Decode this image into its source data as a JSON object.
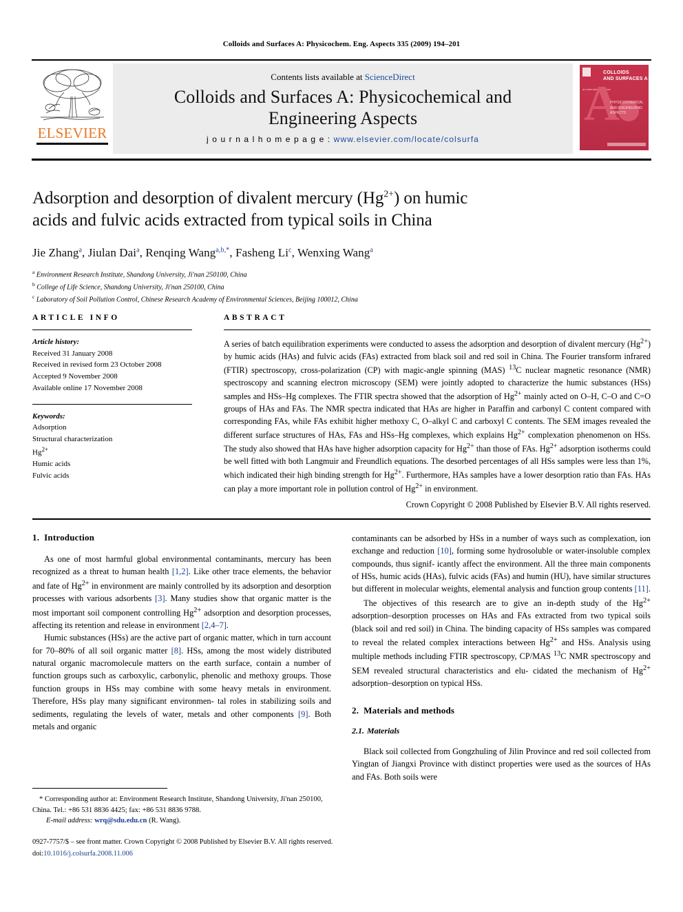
{
  "running_head": "Colloids and Surfaces A: Physicochem. Eng. Aspects 335 (2009) 194–201",
  "masthead": {
    "publisher_name": "ELSEVIER",
    "contents_prefix": "Contents lists available at ",
    "contents_link": "ScienceDirect",
    "journal_title_line1": "Colloids and Surfaces A: Physicochemical and",
    "journal_title_line2": "Engineering Aspects",
    "homepage_label": "j o u r n a l  h o m e p a g e :",
    "homepage_url": "www.elsevier.com/locate/colsurfa",
    "cover": {
      "line1": "COLLOIDS",
      "line2": "AND SURFACES A",
      "letter": "A",
      "subtitle": "PHYSICOCHEMICAL AND ENGINEERING ASPECTS",
      "small_top": "an international journal"
    }
  },
  "title": {
    "line1_a": "Adsorption and desorption of divalent mercury (Hg",
    "line1_sup": "2+",
    "line1_b": ") on humic",
    "line2": "acids and fulvic acids extracted from typical soils in China"
  },
  "authors": [
    {
      "name": "Jie Zhang",
      "sup": "a"
    },
    {
      "name": "Jiulan Dai",
      "sup": "a"
    },
    {
      "name": "Renqing Wang",
      "sup": "a,b,*"
    },
    {
      "name": "Fasheng Li",
      "sup": "c"
    },
    {
      "name": "Wenxing Wang",
      "sup": "a"
    }
  ],
  "affiliations": [
    {
      "mark": "a",
      "text": "Environment Research Institute, Shandong University, Ji'nan 250100, China"
    },
    {
      "mark": "b",
      "text": "College of Life Science, Shandong University, Ji'nan 250100, China"
    },
    {
      "mark": "c",
      "text": "Laboratory of Soil Pollution Control, Chinese Research Academy of Environmental Sciences, Beijing 100012, China"
    }
  ],
  "article_info": {
    "heading": "ARTICLE INFO",
    "history_label": "Article history:",
    "history": [
      "Received 31 January 2008",
      "Received in revised form 23 October 2008",
      "Accepted 9 November 2008",
      "Available online 17 November 2008"
    ],
    "keywords_label": "Keywords:",
    "keywords": [
      "Adsorption",
      "Structural characterization",
      "Hg2+",
      "Humic acids",
      "Fulvic acids"
    ]
  },
  "abstract": {
    "heading": "ABSTRACT",
    "text": "A series of batch equilibration experiments were conducted to assess the adsorption and desorption of divalent mercury (Hg2+) by humic acids (HAs) and fulvic acids (FAs) extracted from black soil and red soil in China. The Fourier transform infrared (FTIR) spectroscopy, cross-polarization (CP) with magic-angle spinning (MAS) 13C nuclear magnetic resonance (NMR) spectroscopy and scanning electron microscopy (SEM) were jointly adopted to characterize the humic substances (HSs) samples and HSs–Hg complexes. The FTIR spectra showed that the adsorption of Hg2+ mainly acted on O–H, C–O and C=O groups of HAs and FAs. The NMR spectra indicated that HAs are higher in Paraffin and carbonyl C content compared with corresponding FAs, while FAs exhibit higher methoxy C, O–alkyl C and carboxyl C contents. The SEM images revealed the different surface structures of HAs, FAs and HSs–Hg complexes, which explains Hg2+ complexation phenomenon on HSs. The study also showed that HAs have higher adsorption capacity for Hg2+ than those of FAs. Hg2+ adsorption isotherms could be well fitted with both Langmuir and Freundlich equations. The desorbed percentages of all HSs samples were less than 1%, which indicated their high binding strength for Hg2+. Furthermore, HAs samples have a lower desorption ratio than FAs. HAs can play a more important role in pollution control of Hg2+ in environment.",
    "copyright": "Crown Copyright © 2008 Published by Elsevier B.V. All rights reserved."
  },
  "sections": {
    "intro_number": "1.",
    "intro_title": "Introduction",
    "intro_p1": "As one of most harmful global environmental contaminants, mercury has been recognized as a threat to human health [1,2]. Like other trace elements, the behavior and fate of Hg2+ in environment are mainly controlled by its adsorption and desorption processes with various adsorbents [3]. Many studies show that organic matter is the most important soil component controlling Hg2+ adsorption and desorption processes, affecting its retention and release in environment [2,4–7].",
    "intro_p2": "Humic substances (HSs) are the active part of organic matter, which in turn account for 70–80% of all soil organic matter [8]. HSs, among the most widely distributed natural organic macromolecule matters on the earth surface, contain a number of function groups such as carboxylic, carbonylic, phenolic and methoxy groups. Those function groups in HSs may combine with some heavy metals in environment. Therefore, HSs play many significant environmental roles in stabilizing soils and sediments, regulating the levels of water, metals and other components [9]. Both metals and organic",
    "intro_p3": "contaminants can be adsorbed by HSs in a number of ways such as complexation, ion exchange and reduction [10], forming some hydrosoluble or water-insoluble complex compounds, thus significantly affect the environment. All the three main components of HSs, humic acids (HAs), fulvic acids (FAs) and humin (HU), have similar structures but different in molecular weights, elemental analysis and function group contents [11].",
    "intro_p4": "The objectives of this research are to give an in-depth study of the Hg2+ adsorption–desorption processes on HAs and FAs extracted from two typical soils (black soil and red soil) in China. The binding capacity of HSs samples was compared to reveal the related complex interactions between Hg2+ and HSs. Analysis using multiple methods including FTIR spectroscopy, CP/MAS 13C NMR spectroscopy and SEM revealed structural characteristics and elucidated the mechanism of Hg2+ adsorption–desorption on typical HSs.",
    "methods_number": "2.",
    "methods_title": "Materials and methods",
    "materials_number": "2.1.",
    "materials_title": "Materials",
    "materials_p1": "Black soil collected from Gongzhuling of Jilin Province and red soil collected from Yingtan of Jiangxi Province with distinct properties were used as the sources of HAs and FAs. Both soils were"
  },
  "footnotes": {
    "corresponding": "* Corresponding author at: Environment Research Institute, Shandong University, Ji'nan 250100, China. Tel.: +86 531 8836 4425; fax: +86 531 8836 9788.",
    "email_label": "E-mail address:",
    "email": "wrq@sdu.edu.cn",
    "email_owner": "(R. Wang)."
  },
  "imprint": {
    "issn_line": "0927-7757/$ – see front matter. Crown Copyright © 2008 Published by Elsevier B.V. All rights reserved.",
    "doi_label": "doi:",
    "doi": "10.1016/j.colsurfa.2008.11.006"
  },
  "colors": {
    "link": "#1a3f8f",
    "elsevier_orange": "#E87722",
    "masthead_bg": "#ececec",
    "cover_red": "#c8324b"
  }
}
